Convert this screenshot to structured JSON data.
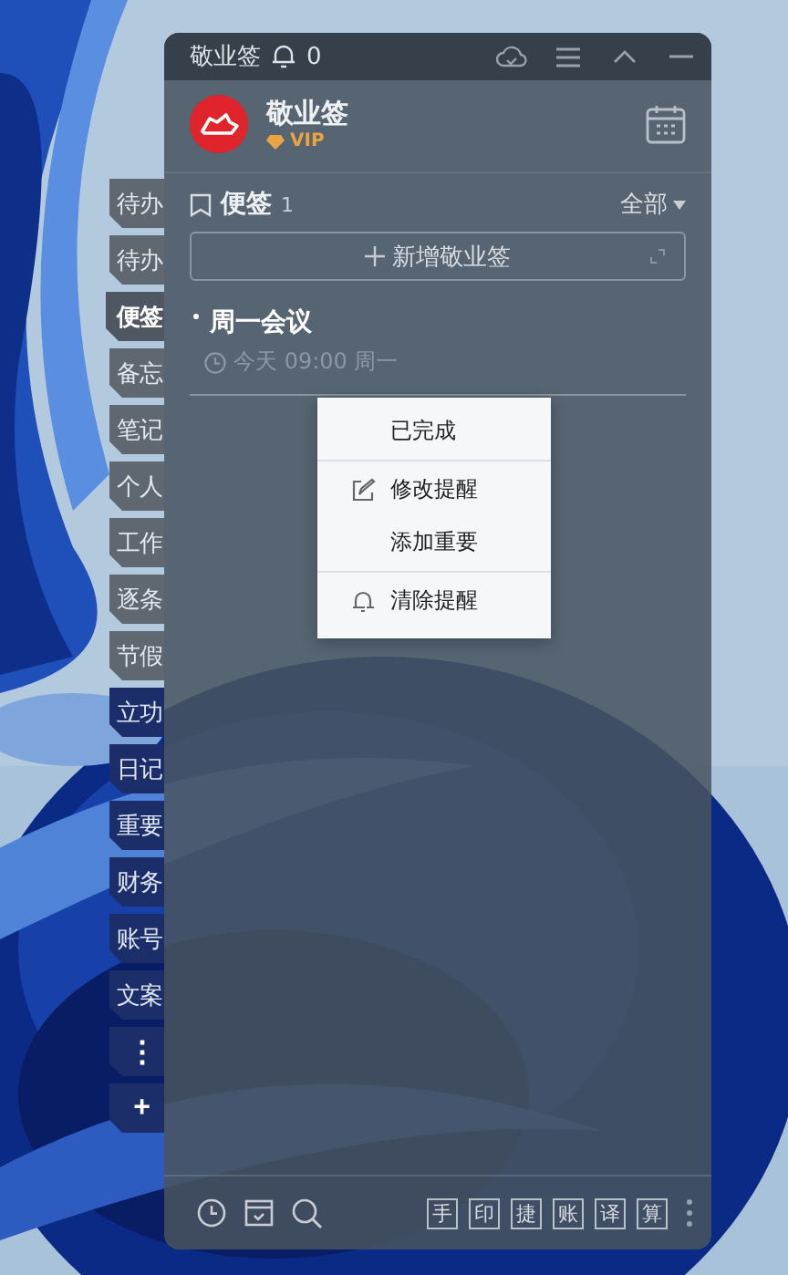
{
  "title_bar": {
    "title": "敬业签",
    "notification_count": "0"
  },
  "profile": {
    "name": "敬业签",
    "badge": "VIP"
  },
  "side_tabs": [
    {
      "label": "待办",
      "selected": false
    },
    {
      "label": "待办",
      "selected": false
    },
    {
      "label": "便签",
      "selected": true
    },
    {
      "label": "备忘",
      "selected": false
    },
    {
      "label": "笔记",
      "selected": false
    },
    {
      "label": "个人",
      "selected": false
    },
    {
      "label": "工作",
      "selected": false
    },
    {
      "label": "逐条",
      "selected": false
    },
    {
      "label": "节假",
      "selected": false
    },
    {
      "label": "立功",
      "selected": false
    },
    {
      "label": "日记",
      "selected": false
    },
    {
      "label": "重要",
      "selected": false
    },
    {
      "label": "财务",
      "selected": false
    },
    {
      "label": "账号",
      "selected": false
    },
    {
      "label": "文案",
      "selected": false
    }
  ],
  "side_more": "⋮",
  "side_add": "+",
  "section": {
    "title": "便签",
    "count": "1",
    "filter": "全部"
  },
  "new_note_button": "新增敬业签",
  "notes": [
    {
      "title": "周一会议",
      "reminder": "今天 09:00 周一"
    }
  ],
  "context_menu": [
    {
      "label": "已完成",
      "kind": "plain",
      "divider_after": true
    },
    {
      "label": "修改提醒",
      "kind": "edit",
      "divider_after": false
    },
    {
      "label": "添加重要",
      "kind": "plain",
      "divider_after": true
    },
    {
      "label": "清除提醒",
      "kind": "bell",
      "divider_after": false
    }
  ],
  "toolbar_tools": [
    "手",
    "印",
    "捷",
    "账",
    "译",
    "算"
  ]
}
